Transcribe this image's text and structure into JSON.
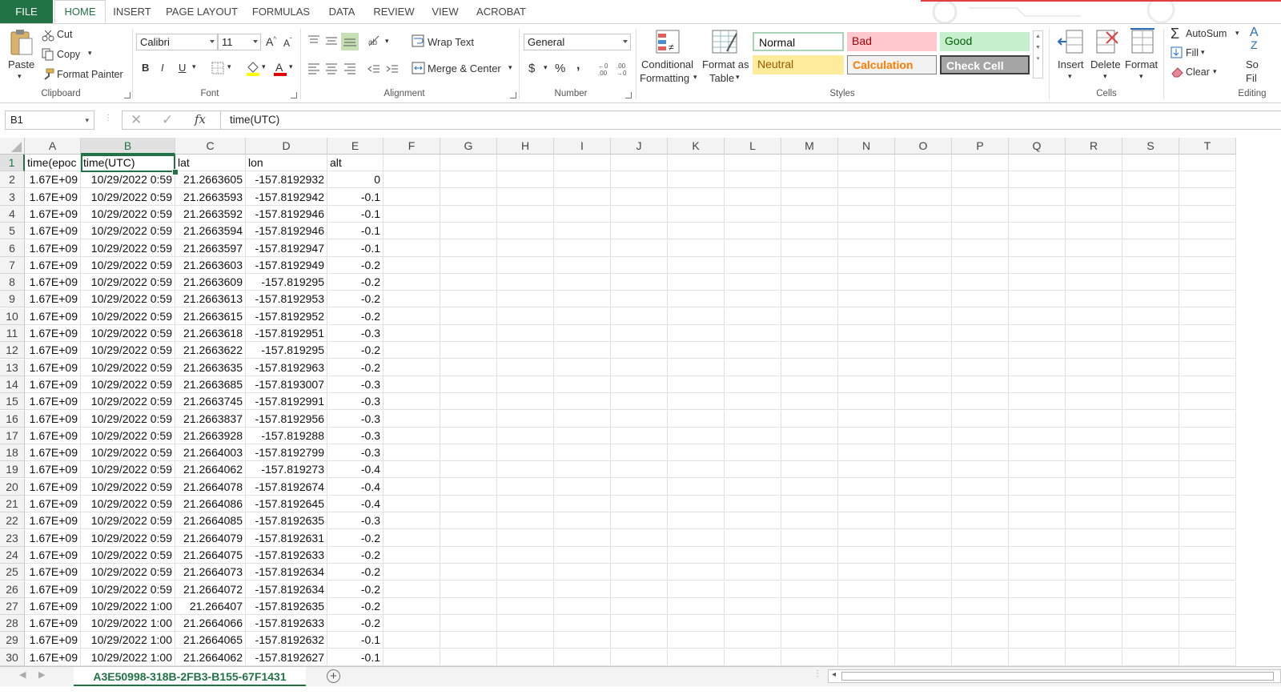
{
  "tabs": {
    "file": "FILE",
    "items": [
      "HOME",
      "INSERT",
      "PAGE LAYOUT",
      "FORMULAS",
      "DATA",
      "REVIEW",
      "VIEW",
      "ACROBAT"
    ],
    "active": "HOME"
  },
  "ribbon": {
    "clipboard": {
      "paste": "Paste",
      "cut": "Cut",
      "copy": "Copy",
      "format_painter": "Format Painter",
      "label": "Clipboard"
    },
    "font": {
      "name": "Calibri",
      "size": "11",
      "bold": "B",
      "italic": "I",
      "underline": "U",
      "label": "Font"
    },
    "alignment": {
      "wrap_text": "Wrap Text",
      "merge_center": "Merge & Center",
      "label": "Alignment"
    },
    "number": {
      "format": "General",
      "currency": "$",
      "percent": "%",
      "comma": ",",
      "label": "Number"
    },
    "styles": {
      "conditional_formatting_1": "Conditional",
      "conditional_formatting_2": "Formatting",
      "format_as_table_1": "Format as",
      "format_as_table_2": "Table",
      "normal": "Normal",
      "bad": "Bad",
      "good": "Good",
      "neutral": "Neutral",
      "calculation": "Calculation",
      "check_cell": "Check Cell",
      "label": "Styles"
    },
    "cells": {
      "insert": "Insert",
      "delete": "Delete",
      "format": "Format",
      "label": "Cells"
    },
    "editing": {
      "autosum": "AutoSum",
      "fill": "Fill",
      "clear": "Clear",
      "sort_partial_1": "So",
      "sort_partial_2": "Fil",
      "label": "Editing"
    }
  },
  "formula_bar": {
    "name_box": "B1",
    "fx": "fx",
    "content": "time(UTC)"
  },
  "columns": [
    "A",
    "B",
    "C",
    "D",
    "E",
    "F",
    "G",
    "H",
    "I",
    "J",
    "K",
    "L",
    "M",
    "N",
    "O",
    "P",
    "Q",
    "R",
    "S",
    "T"
  ],
  "header_row": [
    "time(epoc",
    "time(UTC)",
    "lat",
    "lon",
    "alt"
  ],
  "rows": [
    [
      "1.67E+09",
      "10/29/2022 0:59",
      "21.2663605",
      "-157.8192932",
      "0"
    ],
    [
      "1.67E+09",
      "10/29/2022 0:59",
      "21.2663593",
      "-157.8192942",
      "-0.1"
    ],
    [
      "1.67E+09",
      "10/29/2022 0:59",
      "21.2663592",
      "-157.8192946",
      "-0.1"
    ],
    [
      "1.67E+09",
      "10/29/2022 0:59",
      "21.2663594",
      "-157.8192946",
      "-0.1"
    ],
    [
      "1.67E+09",
      "10/29/2022 0:59",
      "21.2663597",
      "-157.8192947",
      "-0.1"
    ],
    [
      "1.67E+09",
      "10/29/2022 0:59",
      "21.2663603",
      "-157.8192949",
      "-0.2"
    ],
    [
      "1.67E+09",
      "10/29/2022 0:59",
      "21.2663609",
      "-157.819295",
      "-0.2"
    ],
    [
      "1.67E+09",
      "10/29/2022 0:59",
      "21.2663613",
      "-157.8192953",
      "-0.2"
    ],
    [
      "1.67E+09",
      "10/29/2022 0:59",
      "21.2663615",
      "-157.8192952",
      "-0.2"
    ],
    [
      "1.67E+09",
      "10/29/2022 0:59",
      "21.2663618",
      "-157.8192951",
      "-0.3"
    ],
    [
      "1.67E+09",
      "10/29/2022 0:59",
      "21.2663622",
      "-157.819295",
      "-0.2"
    ],
    [
      "1.67E+09",
      "10/29/2022 0:59",
      "21.2663635",
      "-157.8192963",
      "-0.2"
    ],
    [
      "1.67E+09",
      "10/29/2022 0:59",
      "21.2663685",
      "-157.8193007",
      "-0.3"
    ],
    [
      "1.67E+09",
      "10/29/2022 0:59",
      "21.2663745",
      "-157.8192991",
      "-0.3"
    ],
    [
      "1.67E+09",
      "10/29/2022 0:59",
      "21.2663837",
      "-157.8192956",
      "-0.3"
    ],
    [
      "1.67E+09",
      "10/29/2022 0:59",
      "21.2663928",
      "-157.819288",
      "-0.3"
    ],
    [
      "1.67E+09",
      "10/29/2022 0:59",
      "21.2664003",
      "-157.8192799",
      "-0.3"
    ],
    [
      "1.67E+09",
      "10/29/2022 0:59",
      "21.2664062",
      "-157.819273",
      "-0.4"
    ],
    [
      "1.67E+09",
      "10/29/2022 0:59",
      "21.2664078",
      "-157.8192674",
      "-0.4"
    ],
    [
      "1.67E+09",
      "10/29/2022 0:59",
      "21.2664086",
      "-157.8192645",
      "-0.4"
    ],
    [
      "1.67E+09",
      "10/29/2022 0:59",
      "21.2664085",
      "-157.8192635",
      "-0.3"
    ],
    [
      "1.67E+09",
      "10/29/2022 0:59",
      "21.2664079",
      "-157.8192631",
      "-0.2"
    ],
    [
      "1.67E+09",
      "10/29/2022 0:59",
      "21.2664075",
      "-157.8192633",
      "-0.2"
    ],
    [
      "1.67E+09",
      "10/29/2022 0:59",
      "21.2664073",
      "-157.8192634",
      "-0.2"
    ],
    [
      "1.67E+09",
      "10/29/2022 0:59",
      "21.2664072",
      "-157.8192634",
      "-0.2"
    ],
    [
      "1.67E+09",
      "10/29/2022 1:00",
      "21.266407",
      "-157.8192635",
      "-0.2"
    ],
    [
      "1.67E+09",
      "10/29/2022 1:00",
      "21.2664066",
      "-157.8192633",
      "-0.2"
    ],
    [
      "1.67E+09",
      "10/29/2022 1:00",
      "21.2664065",
      "-157.8192632",
      "-0.1"
    ],
    [
      "1.67E+09",
      "10/29/2022 1:00",
      "21.2664062",
      "-157.8192627",
      "-0.1"
    ]
  ],
  "sheet_tab": "A3E50998-318B-2FB3-B155-67F1431",
  "colors": {
    "accent": "#217346",
    "bad_bg": "#ffc7ce",
    "bad_fg": "#9c0006",
    "good_bg": "#c6efce",
    "good_fg": "#006100",
    "neutral_bg": "#ffeb9c",
    "neutral_fg": "#9c5700",
    "calc_bg": "#f2f2f2",
    "calc_fg": "#fa7d00",
    "check_bg": "#a5a5a5"
  }
}
